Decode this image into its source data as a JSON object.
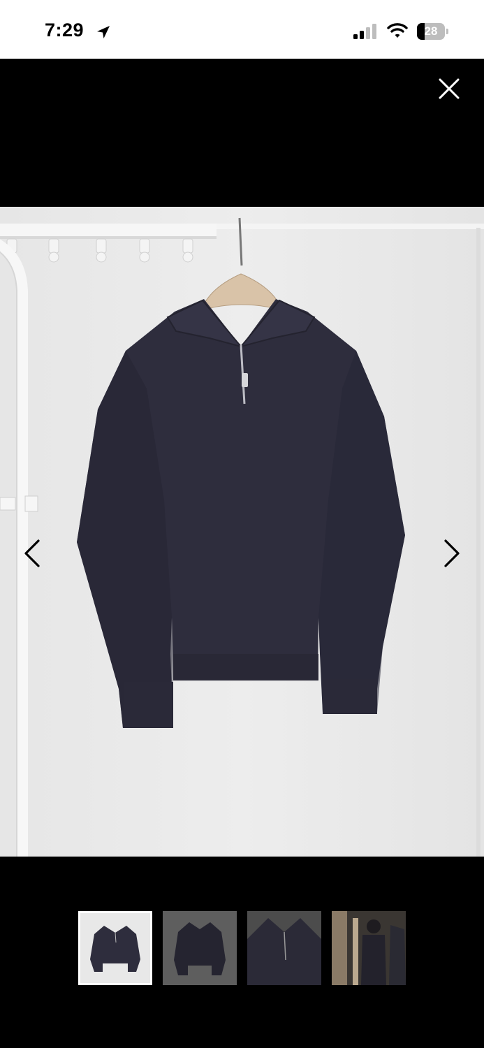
{
  "status_bar": {
    "time": "7:29",
    "battery_level": "28",
    "battery_fraction": 0.28,
    "icons": [
      "location-arrow-icon",
      "cellular-signal-icon",
      "wifi-icon",
      "battery-icon"
    ]
  },
  "viewer": {
    "close_icon": "close-icon",
    "prev_icon": "chevron-left-icon",
    "next_icon": "chevron-right-icon",
    "photo_count": 4,
    "selected_index": 0,
    "thumbnails": [
      "front-view",
      "front-view-grey",
      "collar-detail",
      "styled-on-model"
    ],
    "colors": {
      "garment": "#2e2d3d",
      "backdrop": "#e8e8e8",
      "chrome": "#000000"
    }
  }
}
